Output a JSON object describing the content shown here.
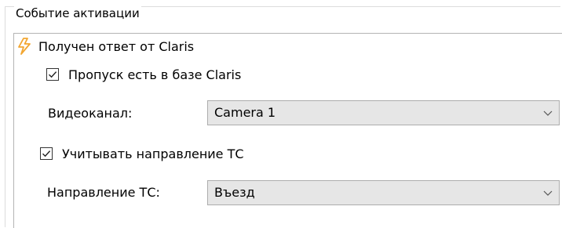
{
  "group": {
    "title": "Событие активации"
  },
  "trigger": {
    "icon": "lightning-bolt-icon",
    "label": "Получен ответ от Claris",
    "icon_color": "#f2a630"
  },
  "pass_in_db": {
    "checked": true,
    "label": "Пропуск есть в базе Claris"
  },
  "video_channel": {
    "label": "Видеоканал:",
    "selected": "Camera 1"
  },
  "consider_direction": {
    "checked": true,
    "label": "Учитывать направление ТС"
  },
  "direction": {
    "label": "Направление ТС:",
    "selected": "Въезд"
  },
  "colors": {
    "dropdown_bg": "#e6e6e6",
    "dropdown_border": "#adadad"
  }
}
